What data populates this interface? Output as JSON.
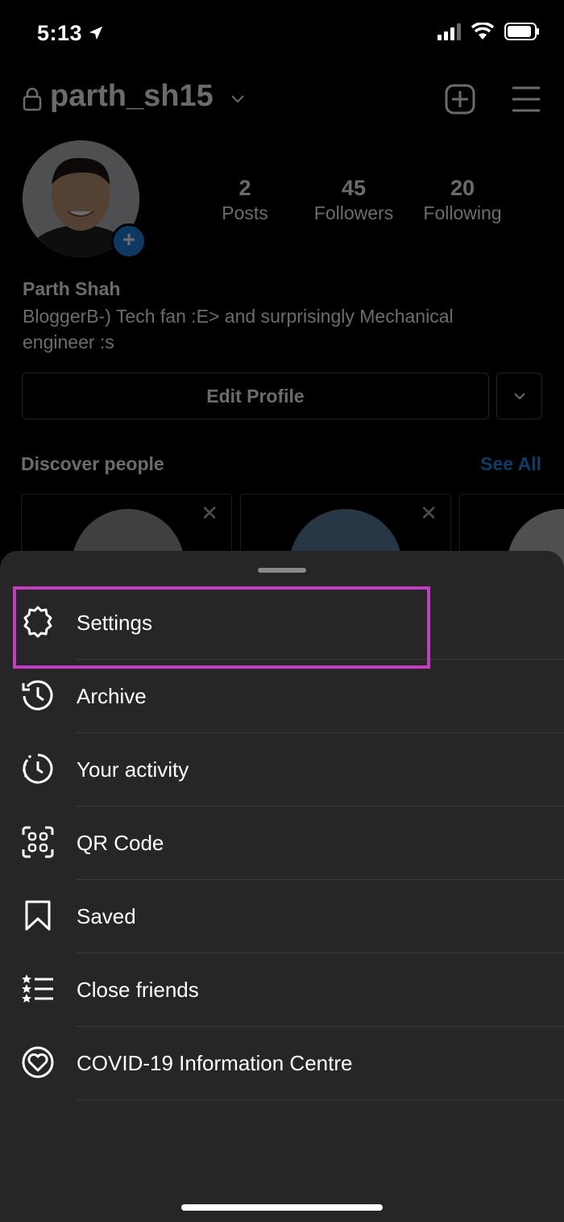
{
  "status_bar": {
    "time": "5:13"
  },
  "profile": {
    "username": "parth_sh15",
    "stats": [
      {
        "value": "2",
        "label": "Posts"
      },
      {
        "value": "45",
        "label": "Followers"
      },
      {
        "value": "20",
        "label": "Following"
      }
    ],
    "full_name": "Parth Shah",
    "bio": "BloggerB-) Tech fan :E> and surprisingly Mechanical engineer :s",
    "edit_profile_label": "Edit Profile",
    "discover_title": "Discover people",
    "see_all_label": "See All"
  },
  "menu": {
    "items": [
      {
        "label": "Settings",
        "icon": "gear-icon"
      },
      {
        "label": "Archive",
        "icon": "archive-icon"
      },
      {
        "label": "Your activity",
        "icon": "activity-icon"
      },
      {
        "label": "QR Code",
        "icon": "qr-code-icon"
      },
      {
        "label": "Saved",
        "icon": "bookmark-icon"
      },
      {
        "label": "Close friends",
        "icon": "close-friends-icon"
      },
      {
        "label": "COVID-19 Information Centre",
        "icon": "covid-info-icon"
      }
    ],
    "highlighted": "Settings"
  },
  "colors": {
    "accent_blue": "#1f8ff2",
    "highlight": "#c43bc4",
    "sheet_bg": "#262626"
  }
}
